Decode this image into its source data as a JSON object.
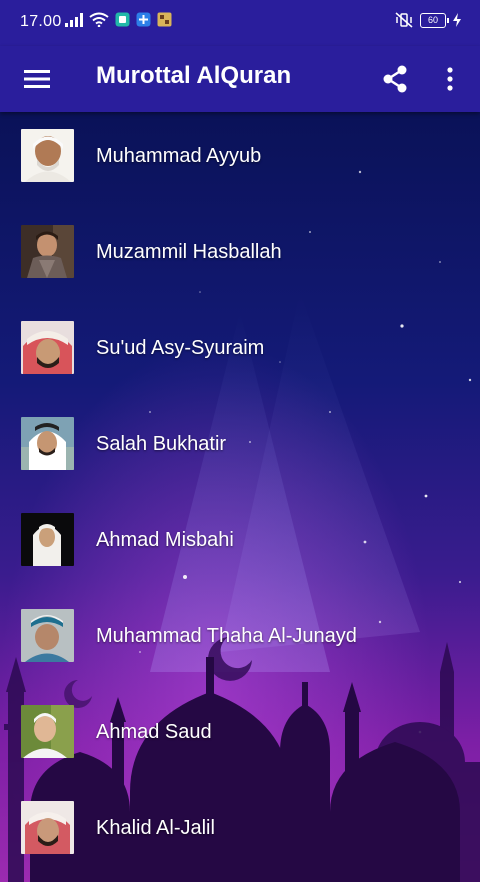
{
  "status_bar": {
    "time": "17.00",
    "battery": "60"
  },
  "app_bar": {
    "title": "Murottal AlQuran",
    "menu_icon": "hamburger-menu-icon",
    "share_icon": "share-icon",
    "overflow_icon": "more-vert-icon"
  },
  "colors": {
    "app_bar": "#2a1e9c",
    "bg_top": "#0c1460",
    "bg_bottom": "#8a1fa8",
    "text": "#ffffff"
  },
  "reciters": [
    {
      "name": "Muhammad Ayyub"
    },
    {
      "name": "Muzammil Hasballah"
    },
    {
      "name": "Su'ud Asy-Syuraim"
    },
    {
      "name": "Salah Bukhatir"
    },
    {
      "name": "Ahmad Misbahi"
    },
    {
      "name": "Muhammad Thaha Al-Junayd"
    },
    {
      "name": "Ahmad Saud"
    },
    {
      "name": "Khalid Al-Jalil"
    }
  ]
}
